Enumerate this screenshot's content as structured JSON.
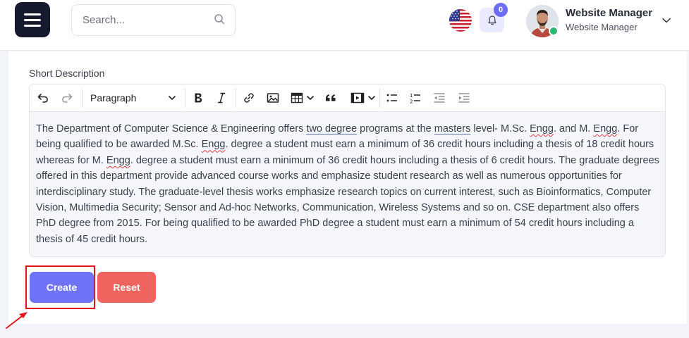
{
  "header": {
    "search_placeholder": "Search...",
    "notification_count": "0",
    "user_name": "Website Manager",
    "user_role": "Website Manager"
  },
  "form": {
    "short_description_label": "Short Description",
    "block_format": "Paragraph",
    "body_segments": [
      "The Department of Computer Science & Engineering offers ",
      "two degree",
      " programs at the ",
      "masters",
      " level- M.Sc. ",
      "Engg",
      ". and M. ",
      "Engg",
      ". For being qualified to be awarded M.Sc. ",
      "Engg",
      ". degree a student must earn a minimum of 36 credit hours including a thesis of 18 credit hours whereas for M. ",
      "Engg",
      ". degree a student must earn a minimum of 36 credit hours including a thesis of 6 credit hours. The graduate degrees offered in this department provide advanced course works and emphasize student research as well as numerous opportunities for interdisciplinary study. The graduate-level thesis works emphasize research topics on current interest, such as Bioinformatics, Computer Vision, Multimedia Security; Sensor and Ad-hoc Networks, Communication, Wireless Systems and so on. CSE department also offers PhD degree from 2015. For being qualified to be awarded PhD degree a student must earn a minimum of 54 credit hours including a thesis of 45 credit hours."
    ],
    "create_label": "Create",
    "reset_label": "Reset"
  },
  "colors": {
    "menu_button": "#161a2f",
    "create_button": "#6f73f7",
    "reset_button": "#f0645f",
    "badge": "#6c6ff5",
    "online_status": "#2bb673",
    "annotation": "#e3181c"
  },
  "icons": {
    "toolbar": [
      "undo-icon",
      "redo-icon",
      "bold-icon",
      "italic-icon",
      "link-icon",
      "image-icon",
      "table-icon",
      "blockquote-icon",
      "media-icon",
      "bulleted-list-icon",
      "numbered-list-icon",
      "outdent-icon",
      "indent-icon"
    ]
  }
}
